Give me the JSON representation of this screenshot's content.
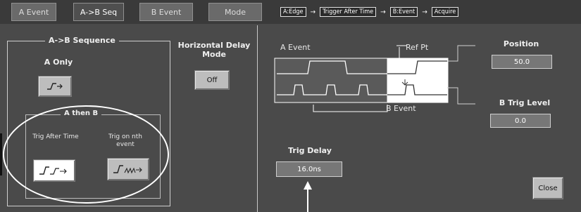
{
  "tabs": [
    {
      "label": "A Event",
      "active": false
    },
    {
      "label": "A->B Seq",
      "active": true
    },
    {
      "label": "B Event",
      "active": false
    },
    {
      "label": "Mode",
      "active": false
    }
  ],
  "flow": [
    "A:Edge",
    "Trigger After Time",
    "B:Event",
    "Acquire"
  ],
  "sequence": {
    "title": "A->B Sequence",
    "a_only_label": "A Only",
    "a_then_b_title": "A then B",
    "trig_after_time_label": "Trig After Time",
    "trig_on_nth_label": "Trig on nth event"
  },
  "horizontal_delay": {
    "label": "Horizontal Delay Mode",
    "button_label": "Off"
  },
  "diagram": {
    "a_event_label": "A Event",
    "ref_pt_label": "Ref Pt",
    "b_event_label": "B Event"
  },
  "position": {
    "label": "Position",
    "value": "50.0"
  },
  "b_trig_level": {
    "label": "B Trig Level",
    "value": "0.0"
  },
  "trig_delay": {
    "label": "Trig Delay",
    "value": "16.0ns"
  },
  "close_label": "Close",
  "colors": {
    "panel": "#4a4a4a",
    "button": "#bdbdbd",
    "selected": "#ffffff"
  }
}
